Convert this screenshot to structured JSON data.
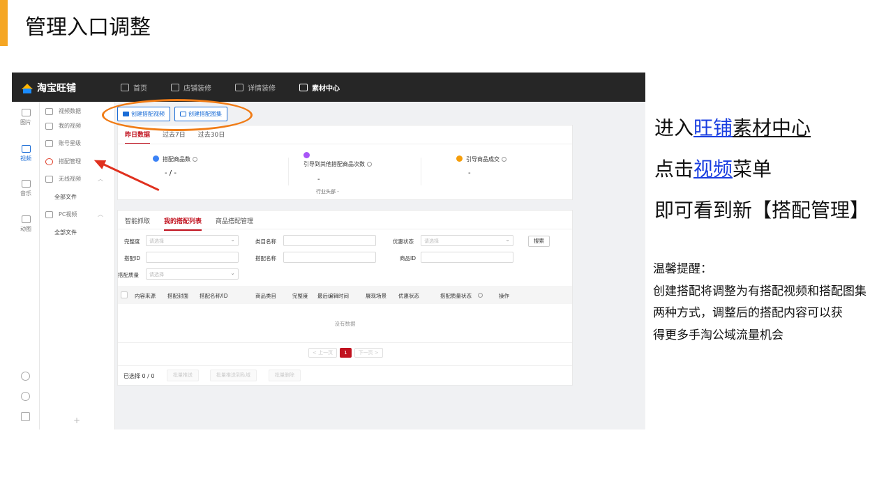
{
  "slide": {
    "title": "管理入口调整",
    "accent_color": "#f5a623"
  },
  "app": {
    "logo_text": "淘宝旺铺",
    "nav": [
      {
        "label": "首页",
        "icon": "home-icon"
      },
      {
        "label": "店铺装修",
        "icon": "store-icon"
      },
      {
        "label": "详情装修",
        "icon": "document-icon"
      },
      {
        "label": "素材中心",
        "icon": "folder-icon",
        "active": true
      }
    ],
    "rail": [
      {
        "label": "图片",
        "icon": "image-icon"
      },
      {
        "label": "视频",
        "icon": "video-icon",
        "active": true
      },
      {
        "label": "音乐",
        "icon": "music-icon"
      },
      {
        "label": "动图",
        "icon": "gif-icon"
      }
    ],
    "sidenav": {
      "items": [
        {
          "label": "视频数据",
          "icon": "chart-icon"
        },
        {
          "label": "我的视频",
          "icon": "list-icon"
        },
        {
          "label": "账号星级",
          "icon": "star-icon"
        },
        {
          "label": "搭配管理",
          "icon": "match-icon"
        },
        {
          "label": "无线视频",
          "icon": "mobile-icon"
        },
        {
          "label": "全部文件"
        },
        {
          "label": "PC视频",
          "icon": "monitor-icon"
        },
        {
          "label": "全部文件"
        }
      ],
      "plus": "+"
    },
    "buttons": {
      "create_video": "创建搭配视频",
      "create_gallery": "创建搭配图集"
    },
    "stats": {
      "tabs": [
        "昨日数据",
        "过去7日",
        "过去30日"
      ],
      "items": [
        {
          "label": "搭配商品数",
          "value": "- / -",
          "color": "#3b82f6"
        },
        {
          "label": "引导到其他搭配商品次数",
          "value": "-",
          "sub": "行业头部 -",
          "color": "#a855f7"
        },
        {
          "label": "引导商品成交",
          "value": "-",
          "color": "#f59e0b"
        }
      ]
    },
    "list": {
      "tabs": [
        "智能抓取",
        "我的搭配列表",
        "商品搭配管理"
      ],
      "filters": {
        "completeness": {
          "label": "完整度",
          "placeholder": "请选择"
        },
        "category_name": {
          "label": "类目名称"
        },
        "promo_status": {
          "label": "优惠状态",
          "placeholder": "请选择"
        },
        "search": "搜索",
        "match_id": {
          "label": "搭配ID"
        },
        "match_name": {
          "label": "搭配名称"
        },
        "product_id": {
          "label": "商品ID"
        },
        "match_quality": {
          "label": "搭配质量",
          "placeholder": "请选择"
        }
      },
      "columns": [
        "内容来源",
        "搭配封面",
        "搭配名称/ID",
        "商品类目",
        "完整度",
        "最后编辑时间",
        "展现场景",
        "优惠状态",
        "搭配质量状态",
        "操作"
      ],
      "empty_text": "没有数据",
      "pager": {
        "prev": "< 上一页",
        "current": "1",
        "next": "下一页 >"
      },
      "selected_text": "已选择 0 / 0",
      "bulk": [
        "批量推送",
        "批量推送到私域",
        "批量删除"
      ]
    }
  },
  "notes": {
    "line1": {
      "pre": "进入",
      "link": "旺铺",
      "post": "素材中心"
    },
    "line2": {
      "pre": "点击",
      "link": "视频",
      "post": "菜单"
    },
    "line3": "即可看到新【搭配管理】",
    "tip_title": "温馨提醒：",
    "tip_lines": [
      "创建搭配将调整为有搭配视频和搭配图集",
      "两种方式，调整后的搭配内容可以获",
      "得更多手淘公域流量机会"
    ]
  }
}
